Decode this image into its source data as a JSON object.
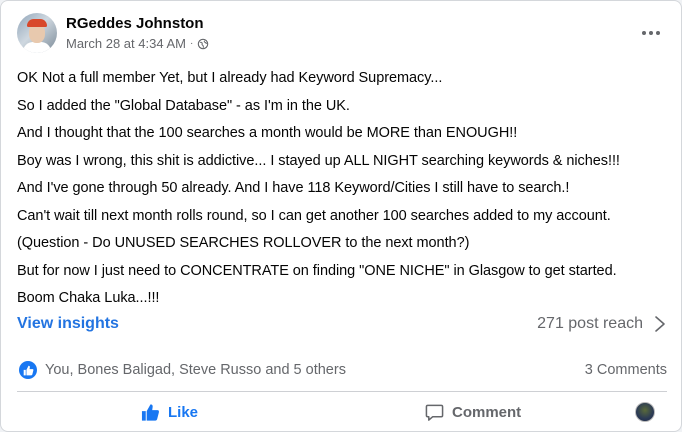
{
  "post": {
    "author": "RGeddes Johnston",
    "timestamp": "March 28 at 4:34 AM",
    "separator": "·",
    "audience_icon": "globe-icon",
    "lines": [
      "OK Not a full member Yet, but I already had Keyword Supremacy...",
      "So I added the \"Global Database\" - as I'm in the UK.",
      "And I thought that the 100 searches a month would be MORE than ENOUGH!!",
      "Boy was I wrong, this shit is addictive... I stayed up ALL NIGHT searching keywords & niches!!!",
      "And I've gone through 50 already. And I have 118 Keyword/Cities I still have to search.!",
      "Can't wait till next month rolls round, so I can get another 100 searches added to my account.",
      "(Question - Do UNUSED SEARCHES ROLLOVER to the next month?)",
      "But for now I just need to CONCENTRATE on finding \"ONE NICHE\" in Glasgow to get started.",
      "Boom Chaka Luka...!!!"
    ]
  },
  "insights": {
    "link_label": "View insights",
    "reach_label": "271 post reach"
  },
  "reactions": {
    "icon": "like-reaction-icon",
    "summary": "You, Bones Baligad, Steve Russo and 5 others",
    "comments": "3 Comments"
  },
  "actions": {
    "like_label": "Like",
    "comment_label": "Comment"
  },
  "colors": {
    "accent": "#1877f2",
    "link": "#2374e1",
    "secondary_text": "#65676b"
  }
}
